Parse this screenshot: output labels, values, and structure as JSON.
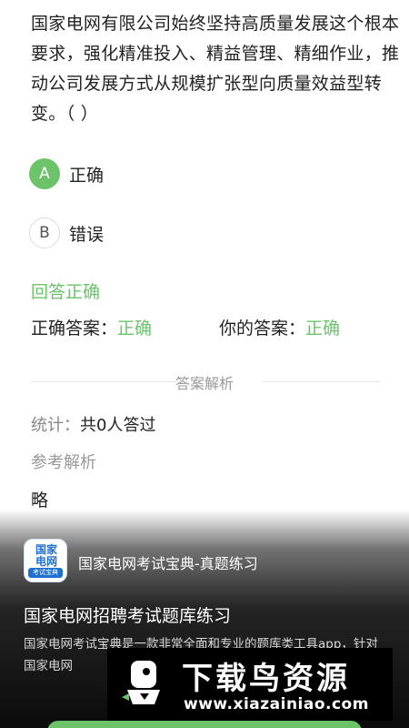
{
  "question": {
    "text": "国家电网有限公司始终坚持高质量发展这个根本要求，强化精准投入、精益管理、精细作业，推动公司发展方式从规模扩张型向质量效益型转变。（ ）"
  },
  "options": [
    {
      "letter": "A",
      "label": "正确"
    },
    {
      "letter": "B",
      "label": "错误"
    }
  ],
  "result": {
    "text": "回答正确"
  },
  "answers": {
    "correct_label": "正确答案：",
    "correct_value": "正确",
    "yours_label": "你的答案：",
    "yours_value": "正确"
  },
  "analysis": {
    "section_title": "答案解析",
    "stats_label": "统计：",
    "stats_value": "共0人答过",
    "reference_title": "参考解析",
    "reference_body": "略"
  },
  "promo": {
    "icon_line1": "国家",
    "icon_line2": "电网",
    "icon_badge": "考试宝典",
    "app_name": "国家电网考试宝典-真题练习",
    "title": "国家电网招聘考试题库练习",
    "description": "国家电网考试宝典是一款非常全面和专业的题库类工具app，针对国家电网"
  },
  "watermark": {
    "text": "下载鸟资源",
    "url": "www.xiazainiao.com"
  },
  "colors": {
    "accent_green": "#6cc36a",
    "text_dark": "#222222",
    "text_muted": "#999999"
  }
}
